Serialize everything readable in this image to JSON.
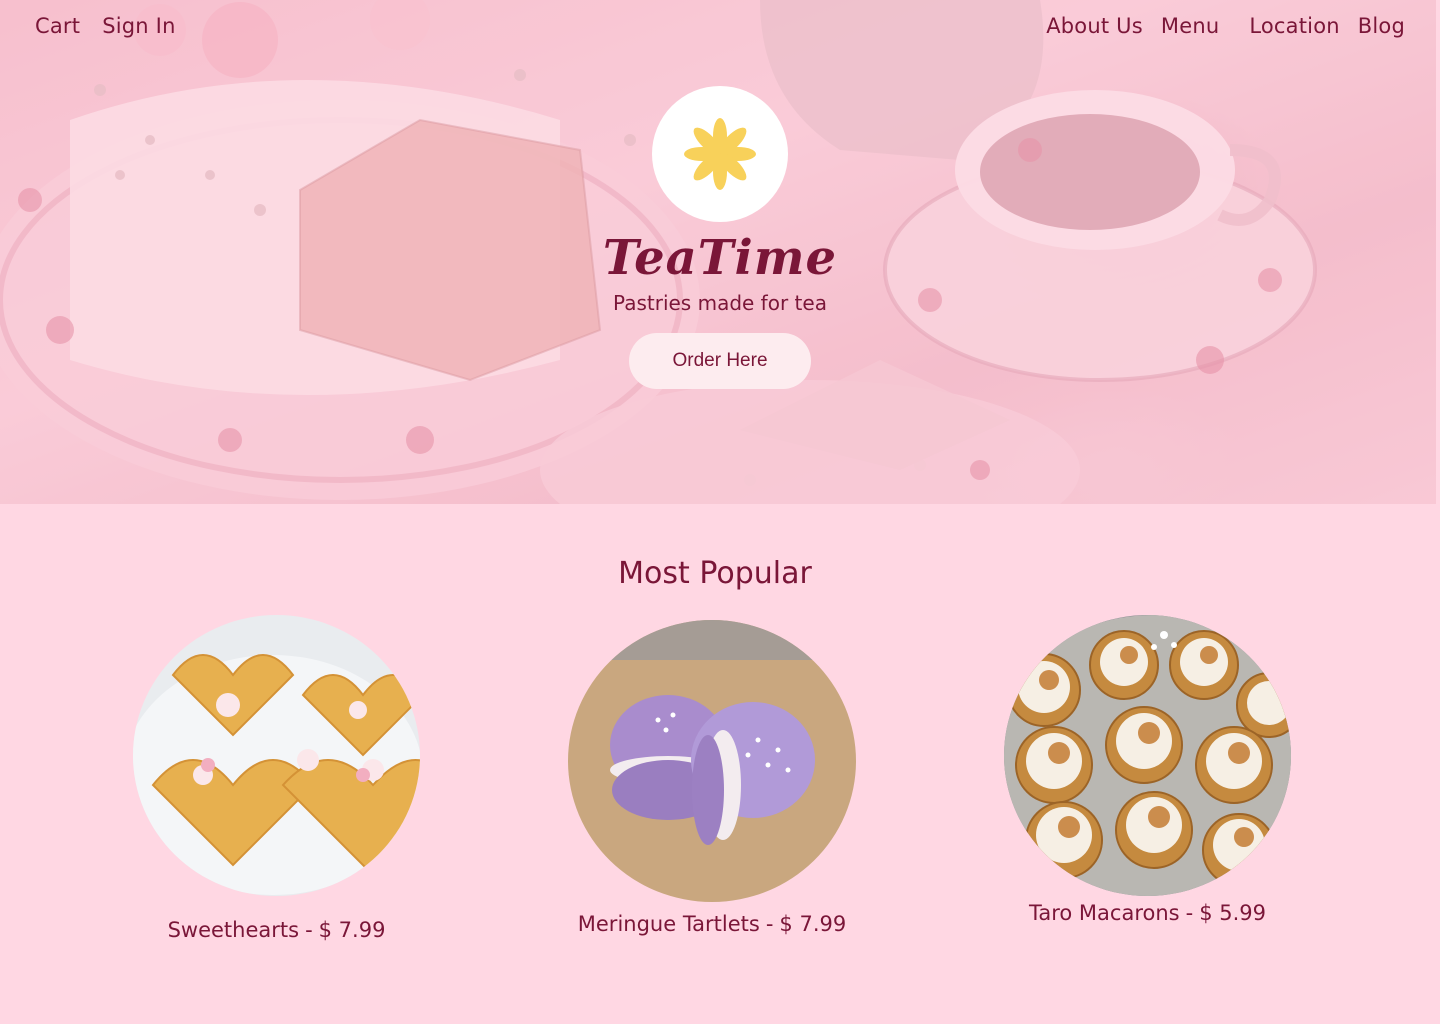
{
  "nav": {
    "left": [
      "Cart",
      "Sign In"
    ],
    "right": [
      "About Us",
      "Menu",
      "Location",
      "Blog"
    ]
  },
  "hero": {
    "logo_icon": "flower-icon",
    "title": "TeaTime",
    "subtitle": "Pastries made for tea",
    "cta_label": "Order Here",
    "background_image": "cake-and-teacup-photo"
  },
  "popular": {
    "title": "Most Popular",
    "items": [
      {
        "name": "Sweethearts",
        "price": "$ 7.99",
        "image": "heart-sponge-cakes-photo"
      },
      {
        "name": "Meringue Tartlets",
        "price": "$ 7.99",
        "image": "purple-macarons-photo"
      },
      {
        "name": "Taro Macarons",
        "price": "$ 5.99",
        "image": "meringue-tartlets-photo"
      }
    ]
  },
  "colors": {
    "page_background": "#ffd7e3",
    "text": "#7a1638",
    "button_background": "#fdecef",
    "logo_petals": "#f8d15a"
  }
}
